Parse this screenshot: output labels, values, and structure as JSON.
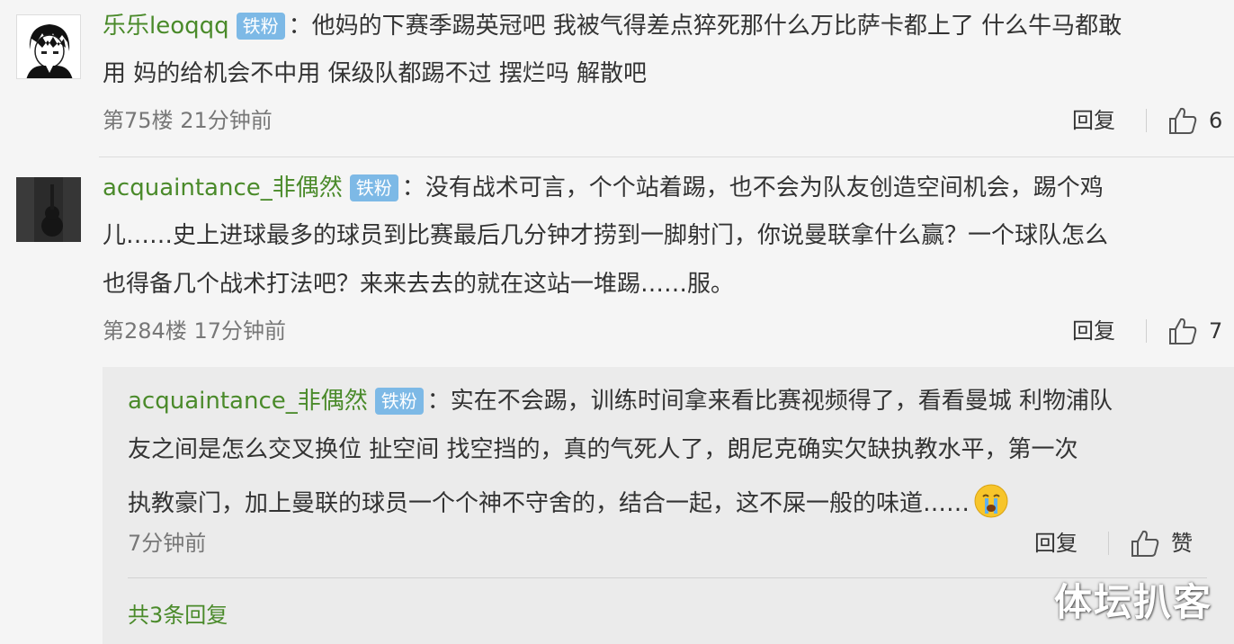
{
  "comments": [
    {
      "username": "乐乐leoqqq",
      "badge": "铁粉",
      "lines": [
        "：他妈的下赛季踢英冠吧 我被气得差点猝死那什么万比萨卡都上了 什么牛马都敢",
        "用 妈的给机会不中用 保级队都踢不过 摆烂吗 解散吧"
      ],
      "floor": "第75楼",
      "time": "21分钟前",
      "reply_label": "回复",
      "likes": "6"
    },
    {
      "username": "acquaintance_非偶然",
      "badge": "铁粉",
      "lines": [
        "：没有战术可言，个个站着踢，也不会为队友创造空间机会，踢个鸡",
        "儿……史上进球最多的球员到比赛最后几分钟才捞到一脚射门，你说曼联拿什么赢？一个球队怎么",
        "也得备几个战术打法吧？来来去去的就在这站一堆踢……服。"
      ],
      "floor": "第284楼",
      "time": "17分钟前",
      "reply_label": "回复",
      "likes": "7"
    }
  ],
  "reply": {
    "username": "acquaintance_非偶然",
    "badge": "铁粉",
    "lines": [
      "：实在不会踢，训练时间拿来看比赛视频得了，看看曼城 利物浦队",
      "友之间是怎么交叉换位 扯空间 找空挡的，真的气死人了，朗尼克确实欠缺执教水平，第一次",
      "执教豪门，加上曼联的球员一个个神不守舍的，结合一起，这不屎一般的味道……"
    ],
    "emoji": "crying-face",
    "time": "7分钟前",
    "reply_label": "回复",
    "like_label": "赞",
    "more_replies": "共3条回复"
  },
  "watermark": "体坛扒客",
  "colors": {
    "username": "#4a8a2a",
    "badge": "#7db9e6",
    "meta": "#777777",
    "background": "#f5f5f5",
    "reply_box": "#ebebeb"
  }
}
